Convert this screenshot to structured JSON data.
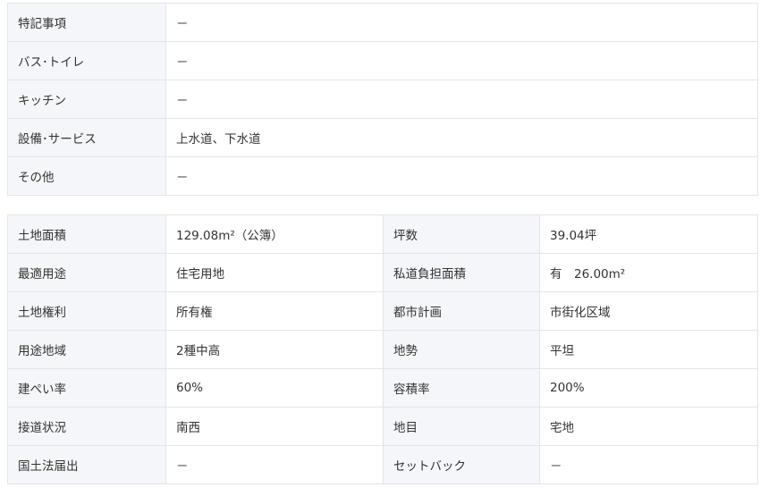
{
  "features": [
    {
      "label": "特記事項",
      "value": "－"
    },
    {
      "label": "バス･トイレ",
      "value": "－"
    },
    {
      "label": "キッチン",
      "value": "－"
    },
    {
      "label": "設備･サービス",
      "value": "上水道、下水道"
    },
    {
      "label": "その他",
      "value": "－"
    }
  ],
  "land": [
    {
      "l1": "土地面積",
      "v1": "129.08m²（公簿）",
      "l2": "坪数",
      "v2": "39.04坪"
    },
    {
      "l1": "最適用途",
      "v1": "住宅用地",
      "l2": "私道負担面積",
      "v2": "有　26.00m²"
    },
    {
      "l1": "土地権利",
      "v1": "所有権",
      "l2": "都市計画",
      "v2": "市街化区域"
    },
    {
      "l1": "用途地域",
      "v1": "2種中高",
      "l2": "地勢",
      "v2": "平坦"
    },
    {
      "l1": "建ぺい率",
      "v1": "60%",
      "l2": "容積率",
      "v2": "200%"
    },
    {
      "l1": "接道状況",
      "v1": "南西",
      "l2": "地目",
      "v2": "宅地"
    },
    {
      "l1": "国土法届出",
      "v1": "－",
      "l2": "セットバック",
      "v2": "－"
    }
  ]
}
